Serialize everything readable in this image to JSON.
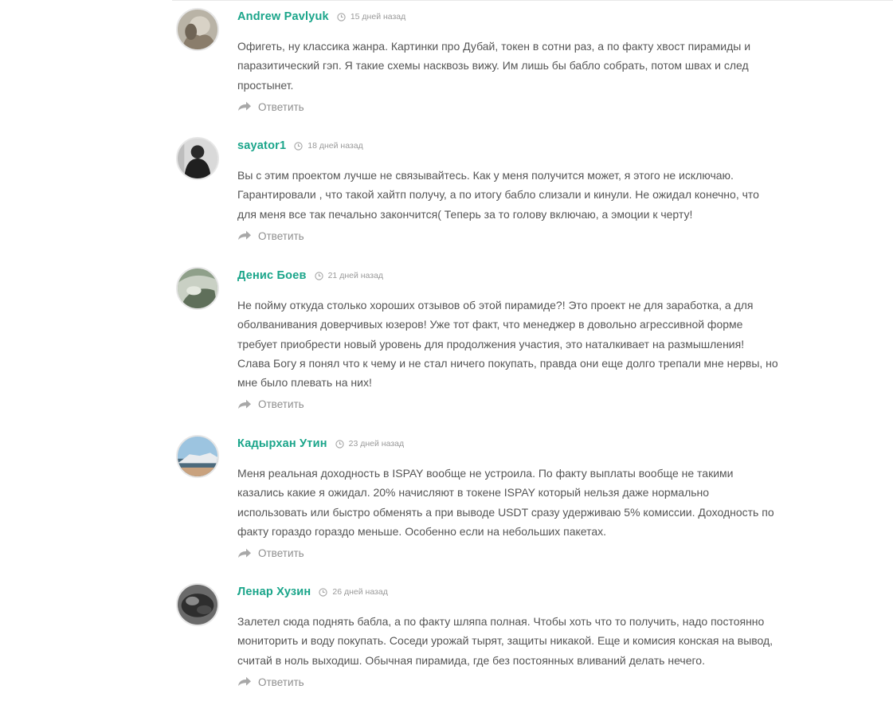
{
  "comments": [
    {
      "author": "Andrew Pavlyuk",
      "time": "15 дней назад",
      "text": "Офигеть, ну классика жанра. Картинки про Дубай, токен в сотни раз, а по факту хвост пирамиды и паразитический гэп. Я такие схемы насквозь вижу. Им лишь бы бабло собрать, потом швах и след простынет.",
      "reply_label": "Ответить"
    },
    {
      "author": "sayator1",
      "time": "18 дней назад",
      "text": "Вы с этим проектом лучше не связывайтесь. Как у меня получится может, я этого не исключаю. Гарантировали , что такой хайтп получу, а по итогу бабло слизали и кинули. Не ожидал конечно, что для меня все так печально закончится( Теперь за то голову включаю, а эмоции к черту!",
      "reply_label": "Ответить"
    },
    {
      "author": "Денис Боев",
      "time": "21 дней назад",
      "text": "Не пойму откуда столько хороших отзывов об этой пирамиде?! Это проект не для заработка, а для оболванивания доверчивых юзеров! Уже тот факт, что менеджер в довольно агрессивной форме требует приобрести новый уровень для продолжения участия, это наталкивает на размышления! Слава Богу я понял что к чему и не стал ничего покупать, правда они еще долго трепали мне нервы, но мне было плевать на них!",
      "reply_label": "Ответить"
    },
    {
      "author": "Кадырхан Утин",
      "time": "23 дней назад",
      "text": "Меня реальная доходность в ISPAY вообще не устроила. По факту выплаты вообще не такими казались какие я ожидал. 20% начисляют в токене ISPAY который нельзя даже нормально использовать или быстро обменять а при выводе USDT сразу удерживаю 5% комиссии. Доходность по факту гораздо гораздо меньше. Особенно если на небольших пакетах.",
      "reply_label": "Ответить"
    },
    {
      "author": "Ленар Хузин",
      "time": "26 дней назад",
      "text": "Залетел сюда поднять бабла, а по факту шляпа полная. Чтобы хоть что то получить, надо постоянно мониторить и воду покупать. Соседи урожай тырят, защиты никакой. Еще и комисия конская на вывод, считай в ноль выходиш. Обычная пирамида, где без постоянных вливаний делать нечего.",
      "reply_label": "Ответить"
    }
  ],
  "colors": {
    "author": "#1aa58a",
    "text": "#555555",
    "meta": "#9a9a9a"
  }
}
